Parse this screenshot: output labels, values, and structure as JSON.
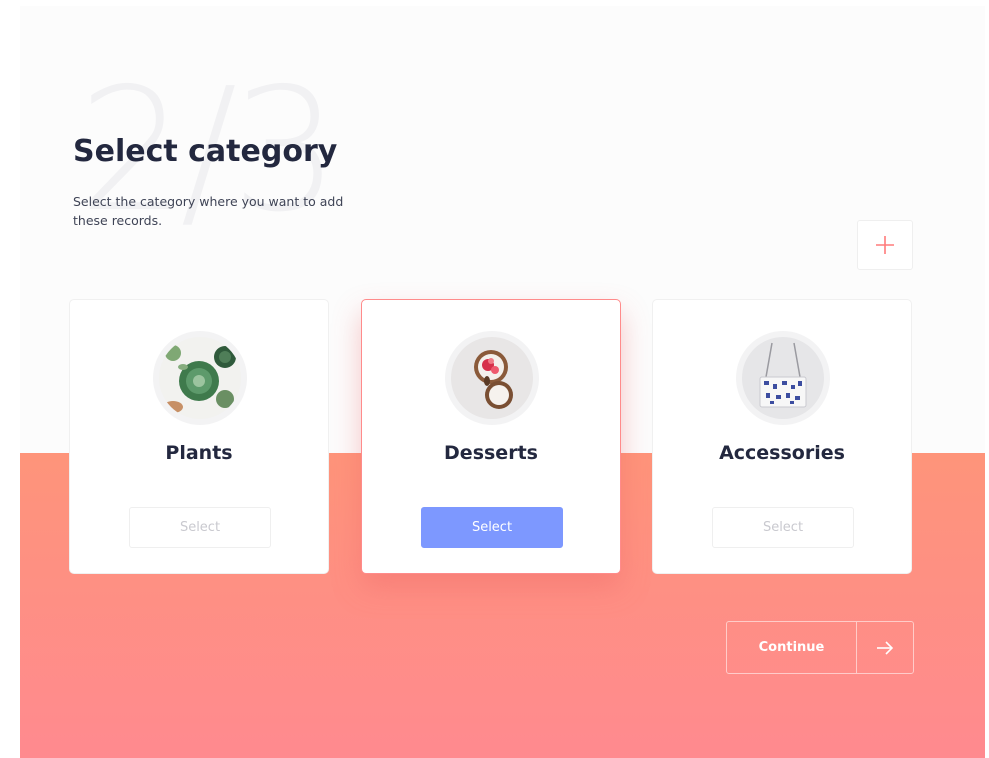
{
  "header": {
    "step": "2/3",
    "title": "Select category",
    "subtitle": "Select the category where you want to add these records."
  },
  "add_button": {
    "icon": "plus-icon"
  },
  "categories": [
    {
      "title": "Plants",
      "select_label": "Select",
      "selected": false,
      "image": "plants-image"
    },
    {
      "title": "Desserts",
      "select_label": "Select",
      "selected": true,
      "image": "desserts-image"
    },
    {
      "title": "Accessories",
      "select_label": "Select",
      "selected": false,
      "image": "accessories-image"
    }
  ],
  "footer": {
    "continue_label": "Continue",
    "arrow_icon": "arrow-right-icon"
  },
  "colors": {
    "accent": "#7d98ff",
    "coral": "#fe947a",
    "pink": "#ff8a8f",
    "title": "#23283f"
  }
}
